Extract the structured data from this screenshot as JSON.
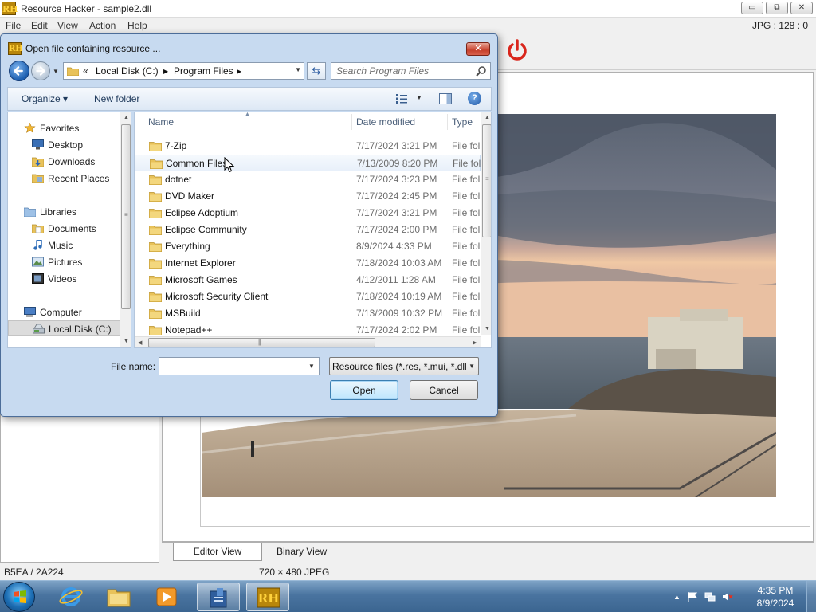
{
  "app": {
    "title": "Resource Hacker - sample2.dll",
    "logo_text": "RH",
    "menu": [
      "File",
      "Edit",
      "View",
      "Action",
      "Help"
    ],
    "resource_info": "JPG : 128 : 0",
    "window_buttons": {
      "minimize": "▭",
      "restore": "⧉",
      "close": "✕"
    },
    "view_tabs": {
      "editor": "Editor View",
      "binary": "Binary View",
      "active": "editor"
    },
    "status": {
      "offsets": "B5EA / 2A224",
      "image_info": "720 × 480  JPEG"
    }
  },
  "dialog": {
    "title": "Open file containing resource ...",
    "close_label": "✕",
    "address": {
      "prefix": "«",
      "parts": [
        "Local Disk (C:)",
        "Program Files"
      ]
    },
    "search_placeholder": "Search Program Files",
    "toolbar": {
      "organize": "Organize ▾",
      "new_folder": "New folder",
      "help": "?"
    },
    "nav": {
      "groups": [
        {
          "label": "Favorites",
          "icon": "star-icon",
          "items": [
            {
              "label": "Desktop",
              "icon": "desktop-icon"
            },
            {
              "label": "Downloads",
              "icon": "downloads-icon"
            },
            {
              "label": "Recent Places",
              "icon": "recent-places-icon"
            }
          ]
        },
        {
          "label": "Libraries",
          "icon": "libraries-icon",
          "items": [
            {
              "label": "Documents",
              "icon": "documents-icon"
            },
            {
              "label": "Music",
              "icon": "music-icon"
            },
            {
              "label": "Pictures",
              "icon": "pictures-icon"
            },
            {
              "label": "Videos",
              "icon": "videos-icon"
            }
          ]
        },
        {
          "label": "Computer",
          "icon": "computer-icon",
          "items": [
            {
              "label": "Local Disk (C:)",
              "icon": "disk-icon",
              "selected": true
            }
          ]
        }
      ]
    },
    "columns": {
      "name": "Name",
      "date": "Date modified",
      "type": "Type"
    },
    "files": [
      {
        "name": "7-Zip",
        "date": "7/17/2024 3:21 PM",
        "type": "File fol"
      },
      {
        "name": "Common Files",
        "date": "7/13/2009 8:20 PM",
        "type": "File fol",
        "hover": true
      },
      {
        "name": "dotnet",
        "date": "7/17/2024 3:23 PM",
        "type": "File fol"
      },
      {
        "name": "DVD Maker",
        "date": "7/17/2024 2:45 PM",
        "type": "File fol"
      },
      {
        "name": "Eclipse Adoptium",
        "date": "7/17/2024 3:21 PM",
        "type": "File fol"
      },
      {
        "name": "Eclipse Community",
        "date": "7/17/2024 2:00 PM",
        "type": "File fol"
      },
      {
        "name": "Everything",
        "date": "8/9/2024 4:33 PM",
        "type": "File fol"
      },
      {
        "name": "Internet Explorer",
        "date": "7/18/2024 10:03 AM",
        "type": "File fol"
      },
      {
        "name": "Microsoft Games",
        "date": "4/12/2011 1:28 AM",
        "type": "File fol"
      },
      {
        "name": "Microsoft Security Client",
        "date": "7/18/2024 10:19 AM",
        "type": "File fol"
      },
      {
        "name": "MSBuild",
        "date": "7/13/2009 10:32 PM",
        "type": "File fol"
      },
      {
        "name": "Notepad++",
        "date": "7/17/2024 2:02 PM",
        "type": "File fol"
      }
    ],
    "file_name_label": "File name:",
    "file_name_value": "",
    "filter": "Resource files (*.res, *.mui, *.dll",
    "open_label": "Open",
    "cancel_label": "Cancel"
  },
  "taskbar": {
    "apps": [
      "windows-explorer-icon",
      "internet-explorer-icon",
      "file-explorer-icon",
      "media-player-icon",
      "setup-icon",
      "resource-hacker-icon"
    ],
    "clock_time": "4:35 PM",
    "clock_date": "8/9/2024"
  },
  "colors": {
    "accent": "#1c5fb0",
    "title_bg": "#c7daf0",
    "taskbar": "#4a74a0",
    "power": "#d9261c"
  }
}
